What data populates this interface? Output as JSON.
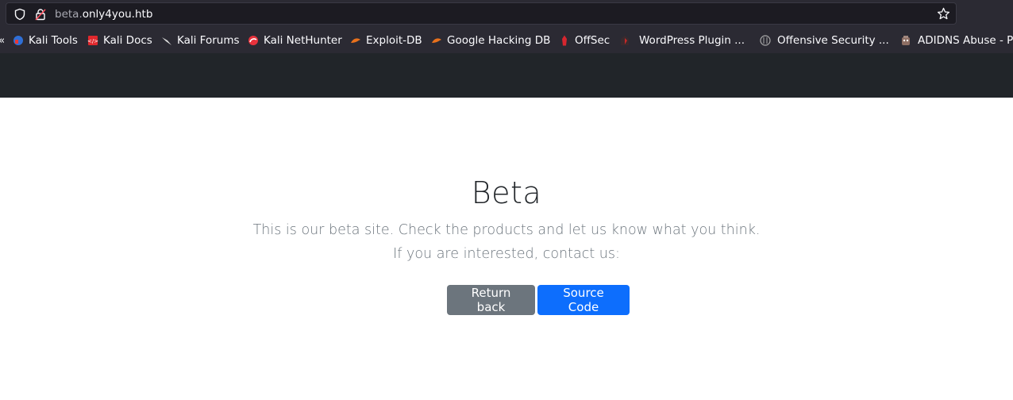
{
  "browser": {
    "url_host_prefix": "beta.",
    "url_host_main": "only4you.htb",
    "bookmarks": [
      {
        "label": "Kali Tools",
        "icon": "kali-tools-icon"
      },
      {
        "label": "Kali Docs",
        "icon": "kali-docs-icon"
      },
      {
        "label": "Kali Forums",
        "icon": "kali-forums-icon"
      },
      {
        "label": "Kali NetHunter",
        "icon": "kali-nethunter-icon"
      },
      {
        "label": "Exploit-DB",
        "icon": "exploit-db-icon"
      },
      {
        "label": "Google Hacking DB",
        "icon": "ghdb-icon"
      },
      {
        "label": "OffSec",
        "icon": "offsec-icon"
      },
      {
        "label": "WordPress Plugin ...",
        "icon": "wordpress-plugin-icon"
      },
      {
        "label": "Offensive Security ...",
        "icon": "offensive-security-icon"
      },
      {
        "label": "ADIDNS Abuse - P",
        "icon": "adidns-icon"
      }
    ]
  },
  "hero": {
    "title": "Beta",
    "lead_line1": "This is our beta site. Check the products and let us know what you think.",
    "lead_line2": "If you are interested, contact us:",
    "return_button": "Return back",
    "source_button": "Source Code"
  },
  "colors": {
    "chrome_bg": "#2b2a33",
    "navbar_bg": "#212529",
    "btn_secondary": "#6c757d",
    "btn_primary": "#0d6efd"
  }
}
